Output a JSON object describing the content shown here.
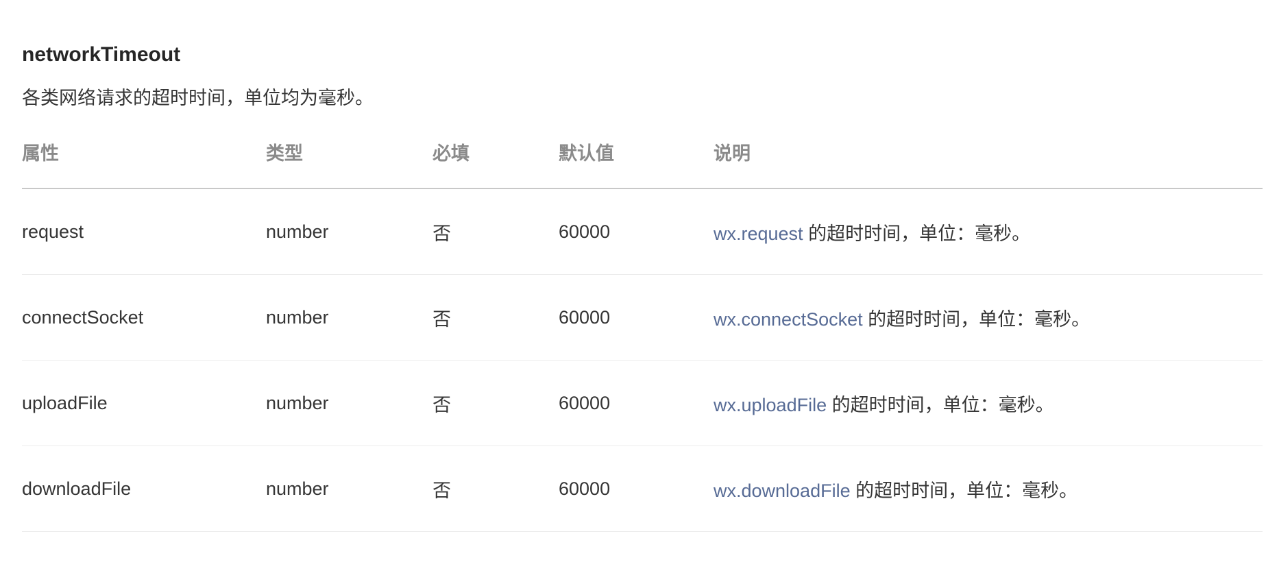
{
  "section": {
    "title": "networkTimeout",
    "description": "各类网络请求的超时时间，单位均为毫秒。"
  },
  "table": {
    "headers": {
      "name": "属性",
      "type": "类型",
      "required": "必填",
      "default": "默认值",
      "description": "说明"
    },
    "rows": [
      {
        "name": "request",
        "type": "number",
        "required": "否",
        "default": "60000",
        "desc_link": "wx.request",
        "desc_text": " 的超时时间，单位：毫秒。"
      },
      {
        "name": "connectSocket",
        "type": "number",
        "required": "否",
        "default": "60000",
        "desc_link": "wx.connectSocket",
        "desc_text": " 的超时时间，单位：毫秒。"
      },
      {
        "name": "uploadFile",
        "type": "number",
        "required": "否",
        "default": "60000",
        "desc_link": "wx.uploadFile",
        "desc_text": " 的超时时间，单位：毫秒。"
      },
      {
        "name": "downloadFile",
        "type": "number",
        "required": "否",
        "default": "60000",
        "desc_link": "wx.downloadFile",
        "desc_text": " 的超时时间，单位：毫秒。"
      }
    ]
  },
  "colors": {
    "link": "#576b95",
    "header_text": "#8a8a8a",
    "body_text": "#353535",
    "title_text": "#262626"
  }
}
